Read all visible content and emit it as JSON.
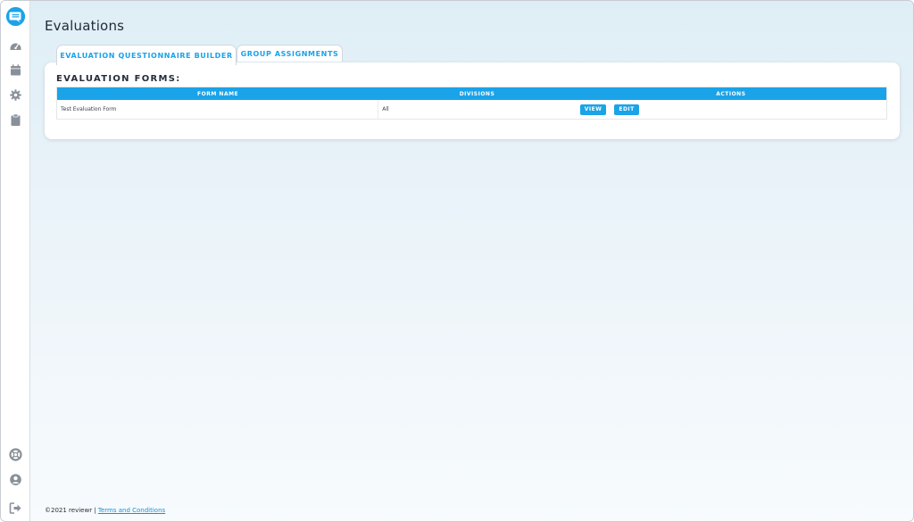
{
  "page": {
    "title": "Evaluations"
  },
  "tabs": [
    {
      "label": "EVALUATION QUESTIONNAIRE BUILDER",
      "active": true
    },
    {
      "label": "GROUP ASSIGNMENTS",
      "active": false
    }
  ],
  "forms_section": {
    "heading": "EVALUATION FORMS:",
    "columns": [
      "FORM NAME",
      "DIVISIONS",
      "ACTIONS"
    ],
    "rows": [
      {
        "form_name": "Test Evaluation Form",
        "divisions": "All",
        "view_label": "VIEW",
        "edit_label": "EDIT"
      }
    ]
  },
  "footer": {
    "copyright": "©2021 reviewr |",
    "terms_link": "Terms and Conditions"
  },
  "sidebar": {
    "icons": [
      "logo-icon",
      "dashboard-icon",
      "calendar-icon",
      "settings-icon",
      "clipboard-icon",
      "help-icon",
      "user-icon",
      "logout-icon"
    ]
  },
  "colors": {
    "accent": "#1aa3e8",
    "sidebar_icon": "#8a9099",
    "title": "#222a3a"
  }
}
